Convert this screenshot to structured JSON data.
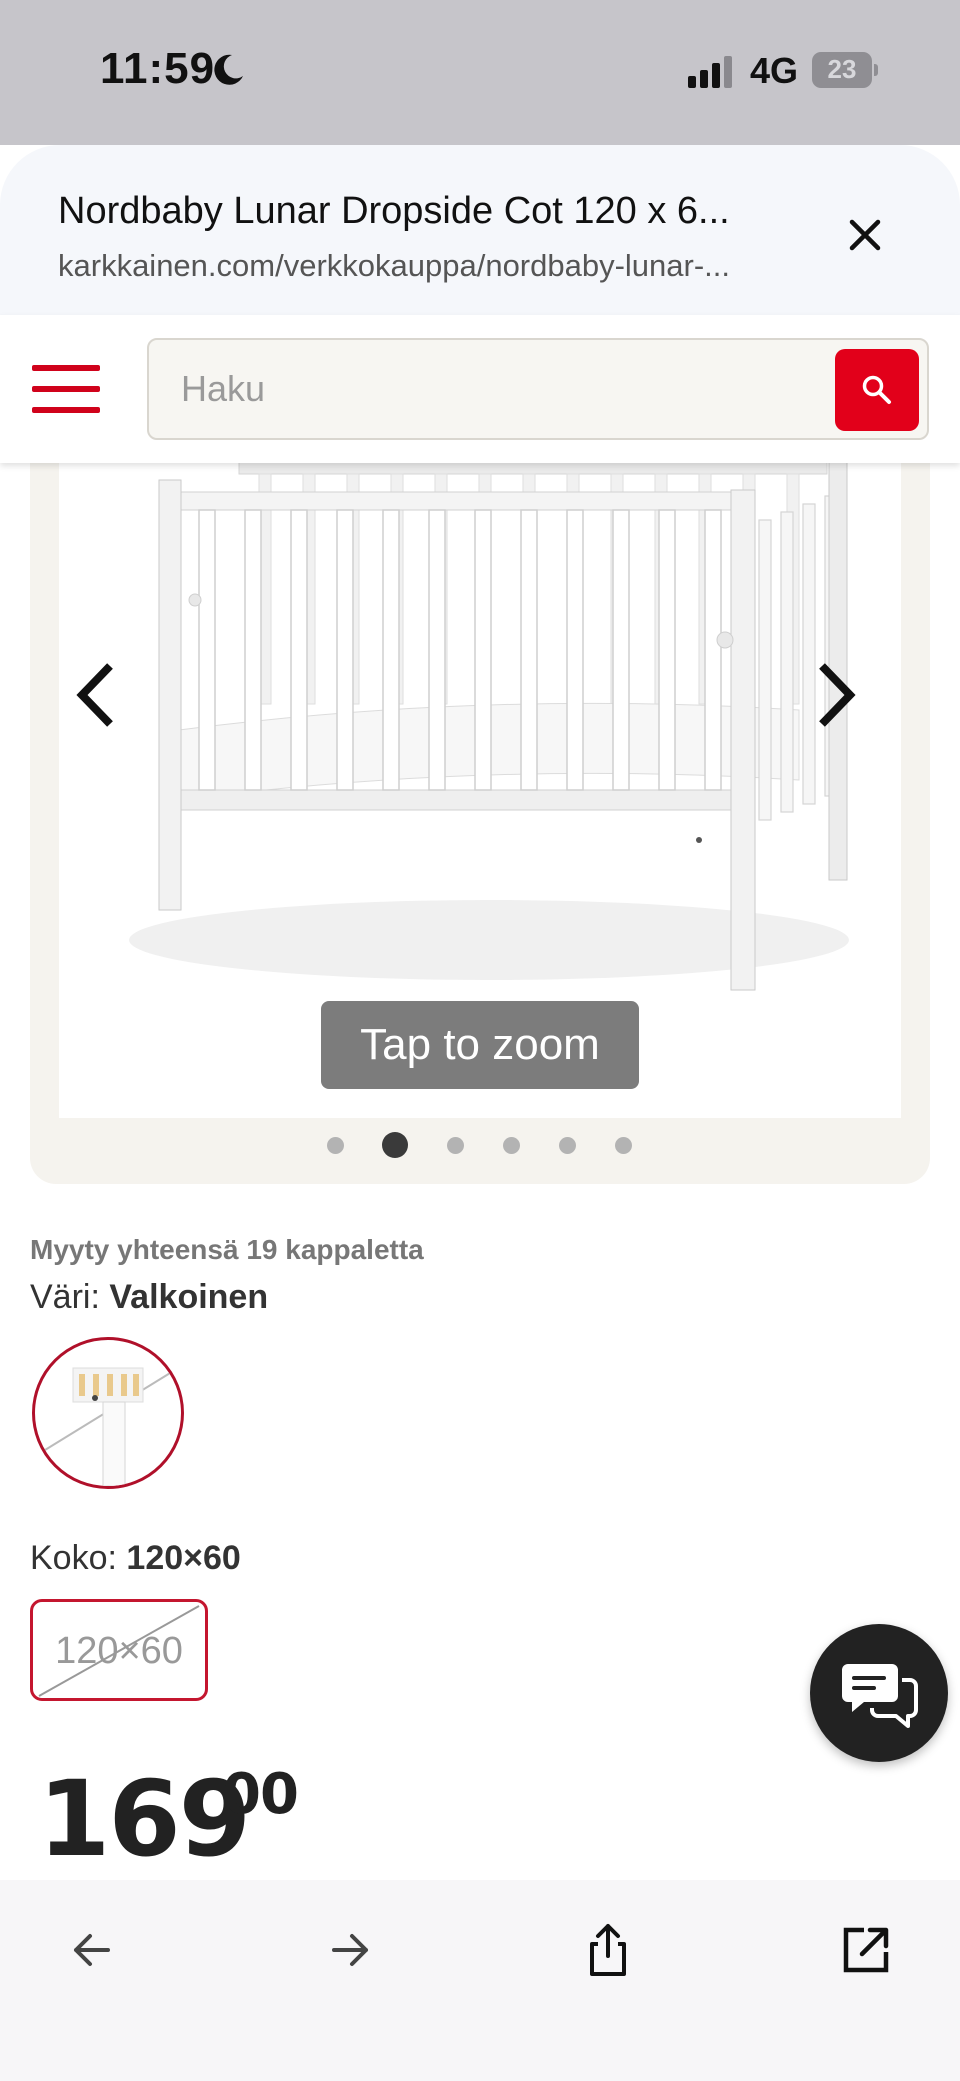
{
  "status_bar": {
    "time": "11:59",
    "network": "4G",
    "battery": "23"
  },
  "browser_sheet": {
    "title": "Nordbaby Lunar Dropside Cot 120 x 6...",
    "url": "karkkainen.com/verkkokauppa/nordbaby-lunar-..."
  },
  "site_nav": {
    "search_placeholder": "Haku",
    "accent_color": "#e2001a"
  },
  "gallery": {
    "zoom_hint": "Tap to zoom",
    "image_count": 6,
    "active_index": 1
  },
  "product": {
    "sold_count": "Myyty yhteensä 19 kappaletta",
    "color_label": "Väri:",
    "color_value": "Valkoinen",
    "size_label": "Koko:",
    "size_value": "120×60",
    "size_option": "120×60",
    "price_whole": "169",
    "price_cents": "00"
  },
  "icons": {
    "close": "close-icon",
    "menu": "hamburger-menu-icon",
    "search": "search-icon",
    "chat": "chat-icon",
    "back": "arrow-left-icon",
    "forward": "arrow-right-icon",
    "share": "share-icon",
    "open_external": "open-external-icon"
  }
}
